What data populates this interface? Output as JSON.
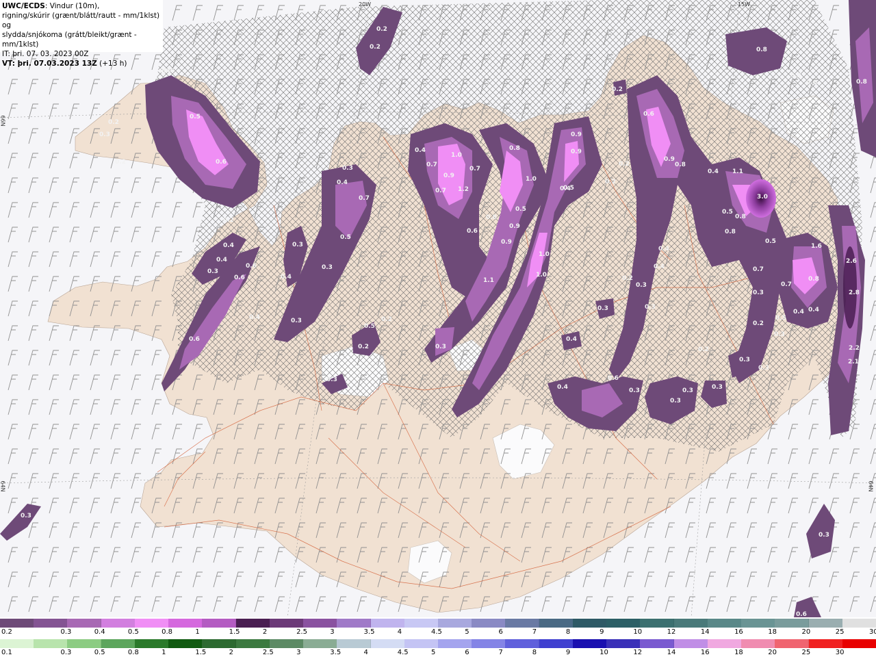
{
  "header": {
    "model": "UWC/ECDS",
    "line1_rest": ": Vindur (10m),",
    "line2": "rigning/skúrir (grænt/blátt/rautt - mm/1klst) og",
    "line3": "slydda/snjókoma (grátt/bleikt/grænt - mm/1klst)",
    "it": "IT: þri. 07. 03. 2023 00Z",
    "vt_bold": "VT: þri. 07.03.2023 13Z",
    "vt_rest": " (+13 h)"
  },
  "graticule_labels": [
    "20W",
    "15W",
    "66N",
    "64N",
    "64N"
  ],
  "precip_labels": [
    "0.2",
    "0.2",
    "0.6",
    "0.3",
    "0.2",
    "0.2",
    "0.5",
    "0.6",
    "0.2",
    "0.4",
    "0.4",
    "0.3",
    "0.6",
    "0.6",
    "0.4",
    "0.3",
    "0.3",
    "0.4",
    "0.7",
    "0.3",
    "0.5",
    "0.3",
    "0.5",
    "0.2",
    "0.2",
    "0.3",
    "0.3",
    "0.6",
    "0.4",
    "1.0",
    "0.7",
    "0.7",
    "0.9",
    "0.7",
    "1.2",
    "0.6",
    "0.8",
    "1.0",
    "0.5",
    "0.8",
    "0.9",
    "0.9",
    "1.1",
    "1.0",
    "1.0",
    "0.5",
    "0.9",
    "0.9",
    "0.4",
    "0.2",
    "0.2",
    "0.6",
    "0.9",
    "0.8",
    "0.4",
    "1.1",
    "3.0",
    "0.8",
    "0.5",
    "0.8",
    "0.5",
    "0.4",
    "0.4",
    "0.3",
    "0.3",
    "0.2",
    "0.4",
    "0.3",
    "0.6",
    "0.2",
    "0.2",
    "0.3",
    "0.3",
    "0.3",
    "0.4",
    "0.3",
    "0.3",
    "0.3",
    "0.7",
    "0.7",
    "0.8",
    "0.5",
    "0.4",
    "0.4",
    "0.3",
    "1.6",
    "2.6",
    "2.8",
    "2.2",
    "2.1",
    "0.8",
    "0.2",
    "0.8",
    "0.6",
    "0.2",
    "0.3",
    "0.6",
    "0.4",
    "0.4",
    "0.3",
    "0.3"
  ],
  "legend": {
    "snow": {
      "labels": [
        "0.2",
        "0.3",
        "0.4",
        "0.5",
        "0.8",
        "1",
        "1.5",
        "2",
        "2.5",
        "3",
        "3.5",
        "4",
        "4.5",
        "5",
        "6",
        "7",
        "8",
        "9",
        "10",
        "12",
        "14",
        "16",
        "18",
        "20",
        "25",
        "30"
      ],
      "colors": [
        "#6e4a78",
        "#845493",
        "#a869b4",
        "#d27fdf",
        "#f08ef5",
        "#d569de",
        "#b45cc2",
        "#4a1e52",
        "#6c3a78",
        "#8a52a0",
        "#a07ac8",
        "#c0b4ee",
        "#c8c8f4",
        "#a8a8de",
        "#8a8ac4",
        "#6a7aa4",
        "#4a6a84",
        "#2e5a66",
        "#2c5f66",
        "#3c7070",
        "#4a7a7a",
        "#5a8888",
        "#6a9494",
        "#7a9c9c",
        "#9aaeb0",
        "#e0e0e0"
      ]
    },
    "rain": {
      "labels": [
        "0.1",
        "0.3",
        "0.5",
        "0.8",
        "1",
        "1.5",
        "2",
        "2.5",
        "3",
        "3.5",
        "4",
        "4.5",
        "5",
        "6",
        "7",
        "8",
        "9",
        "10",
        "12",
        "14",
        "16",
        "18",
        "20",
        "25",
        "30"
      ],
      "colors": [
        "#dcf4d4",
        "#b8e4ac",
        "#8ccc82",
        "#5ca65c",
        "#2a7a2a",
        "#105a10",
        "#2c6a30",
        "#3c7a40",
        "#5c8a64",
        "#8aac94",
        "#b8cad4",
        "#d4dcf4",
        "#c4c4f4",
        "#a4a4ee",
        "#8484e6",
        "#6060dc",
        "#4040d0",
        "#1a10b0",
        "#3a30b8",
        "#7a5ad0",
        "#c08ee6",
        "#f0a8e0",
        "#f08cb0",
        "#f06470",
        "#f02020",
        "#e80000"
      ]
    }
  }
}
